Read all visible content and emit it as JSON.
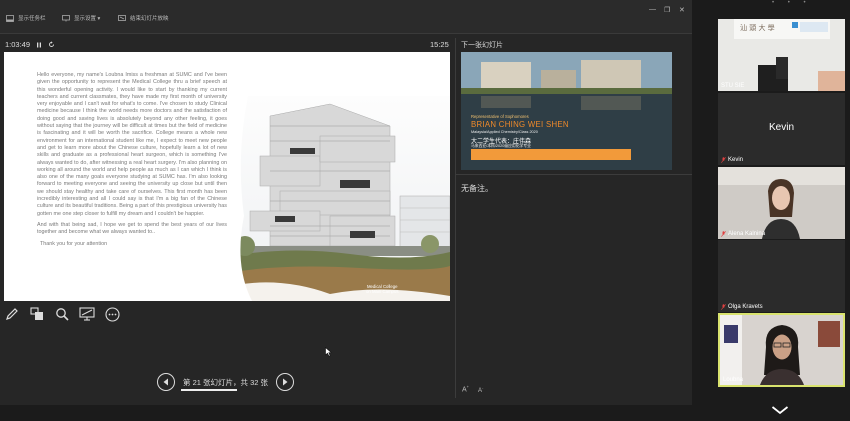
{
  "toolbar": {
    "show_taskbar": "显示任务栏",
    "display_settings": "显示设置 ▾",
    "end_show": "结束幻灯片放映"
  },
  "timer": "1:03:49",
  "clock": "15:25",
  "next_label": "下一张幻灯片",
  "slide": {
    "paragraphs": [
      "Hello everyone, my name's Loubna Imiss a freshman at SUMC and I've been given the opportunity to represent the Medical College thru a brief speech at this wonderful opening activity. I would like to start by thanking my current teachers and current classmates, they have made my first month of university very enjoyable and I can't wait for what's to come. I've chosen to study Clinical medicine because I think the world needs more doctors and the satisfaction of doing good and saving lives is absolutely beyond any other feeling, it goes without saying that the journey will be difficult at times but the field of medicine is fascinating and it will be worth the sacrifice. College means a whole new environment for an international student like me, I expect to meet new people and get to learn more about the Chinese culture, hopefully learn a lot of new skills and graduate as a professional heart surgeon, which is something I've always wanted to do, after witnessing a real heart surgery. I'm also planning on working all around the world and help people as much as I can which I think is also one of the many goals everyone studying at SUMC has. I'm also looking forward to meeting everyone and seeing the university up close but until then we should stay healthy and take care of ourselves. This first month has been incredibly interesting and all I could say is that I'm a big fan of the Chinese culture and its beautiful traditions. Being a part of this prestigious university has gotten me one step closer to fulfill my dream and I couldn't be happier.",
      "And with that being sad, I hope we get to spend the best years of our lives together and become what we always wanted to..",
      "Thank you for your attention"
    ],
    "caption_line1": "Medical College",
    "caption_line2": "on Main Campus"
  },
  "next_slide": {
    "rep": "Representative of Sophomores",
    "name": "BRIAN CHING WEI SHEN",
    "sub1": "Malaysia/Applied Chemistry/Class 2020",
    "sub2": "大二学生代表：庄伟森",
    "sub3": "马来西亚/本科/2020级应用化学专业"
  },
  "notes": "无备注。",
  "font_increase": "A",
  "font_decrease": "A",
  "nav": {
    "text": "第 21 张幻灯片，共 32 张"
  },
  "participants": {
    "top_tile_label": "STU SIE",
    "kevin_big": "Kevin",
    "kevin": "Kevin",
    "alena": "Alena Kalnina",
    "olga": "Olga Kravets",
    "loubna": "Loubna"
  },
  "colors": {
    "accent_active": "#d9e36e",
    "orange": "#f08a2a"
  }
}
